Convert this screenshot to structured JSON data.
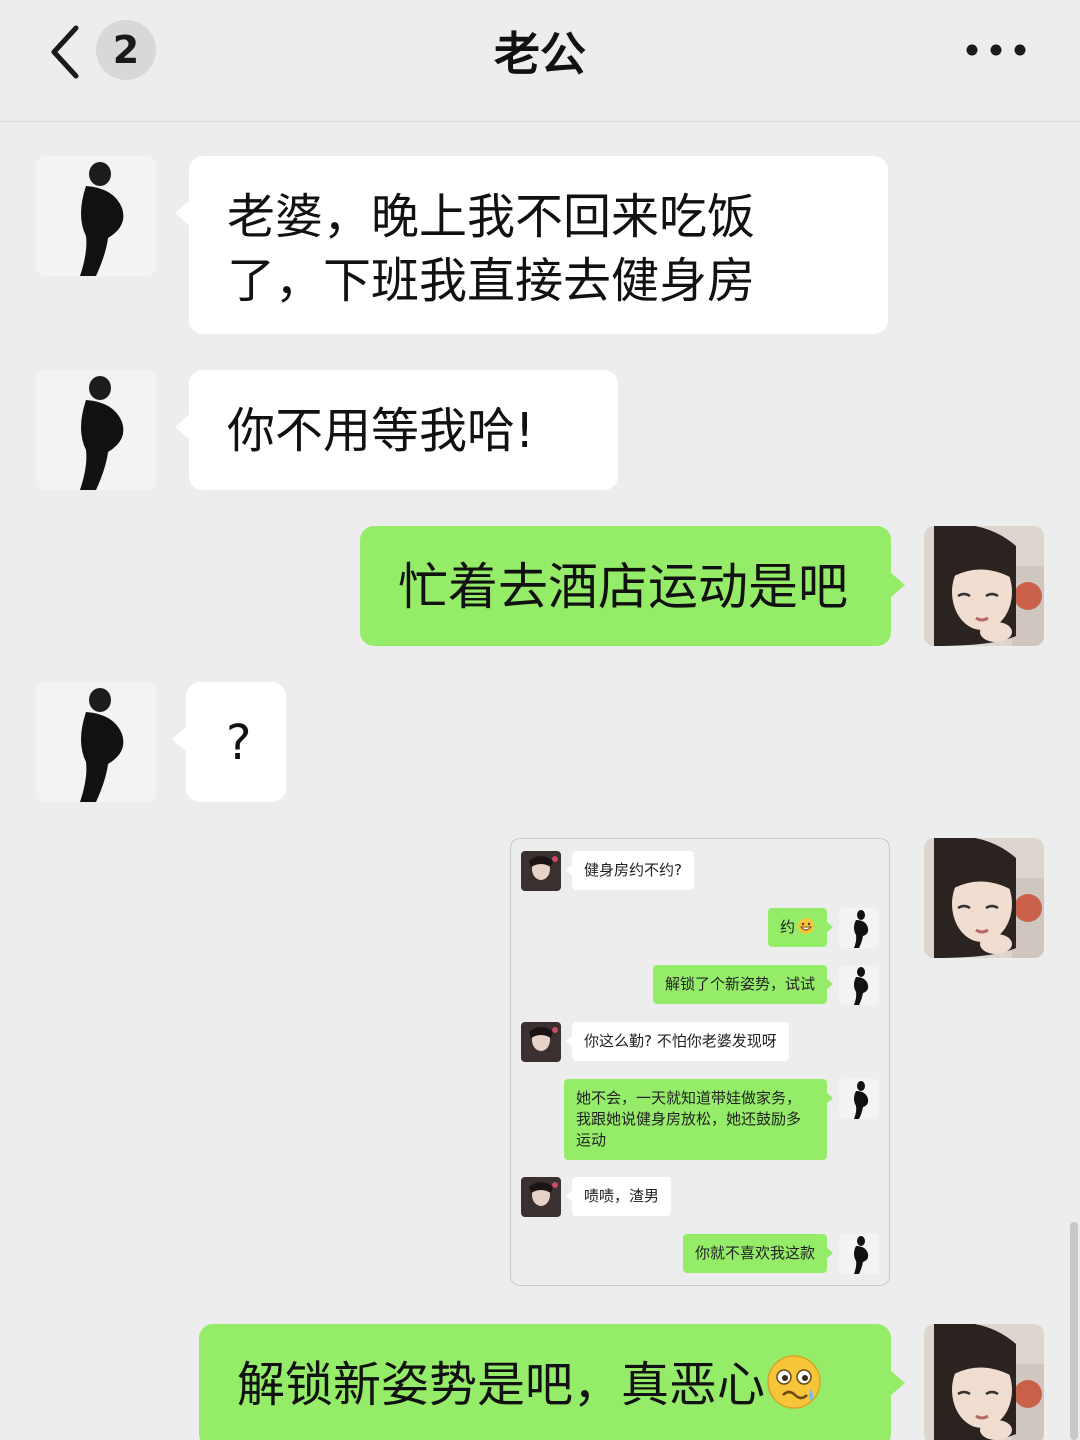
{
  "header": {
    "title": "老公",
    "unread_count": "2",
    "back_icon": "chevron-left-icon",
    "more_icon": "ellipsis-icon"
  },
  "messages": [
    {
      "from": "husband",
      "text": "老婆，晚上我不回来吃饭了，下班我直接去健身房"
    },
    {
      "from": "husband",
      "text": "你不用等我哈!"
    },
    {
      "from": "me",
      "text": "忙着去酒店运动是吧"
    },
    {
      "from": "husband",
      "text": "?"
    },
    {
      "from": "me",
      "type": "image",
      "embedded_chat": [
        {
          "from": "other",
          "text": "健身房约不约?"
        },
        {
          "from": "husband",
          "text": "约",
          "emoji": "grinning-sweat-emoji"
        },
        {
          "from": "husband",
          "text": "解锁了个新姿势，试试"
        },
        {
          "from": "other",
          "text": "你这么勤? 不怕你老婆发现呀"
        },
        {
          "from": "husband",
          "text": "她不会，一天就知道带娃做家务，我跟她说健身房放松，她还鼓励多运动"
        },
        {
          "from": "other",
          "text": "啧啧，渣男"
        },
        {
          "from": "husband",
          "text": "你就不喜欢我这款"
        }
      ]
    },
    {
      "from": "me",
      "text": "解锁新姿势是吧，真恶心",
      "emoji": "woozy-tear-emoji"
    }
  ],
  "colors": {
    "background": "#ededed",
    "incoming_bubble": "#ffffff",
    "outgoing_bubble": "#95ec69",
    "text": "#111111"
  }
}
